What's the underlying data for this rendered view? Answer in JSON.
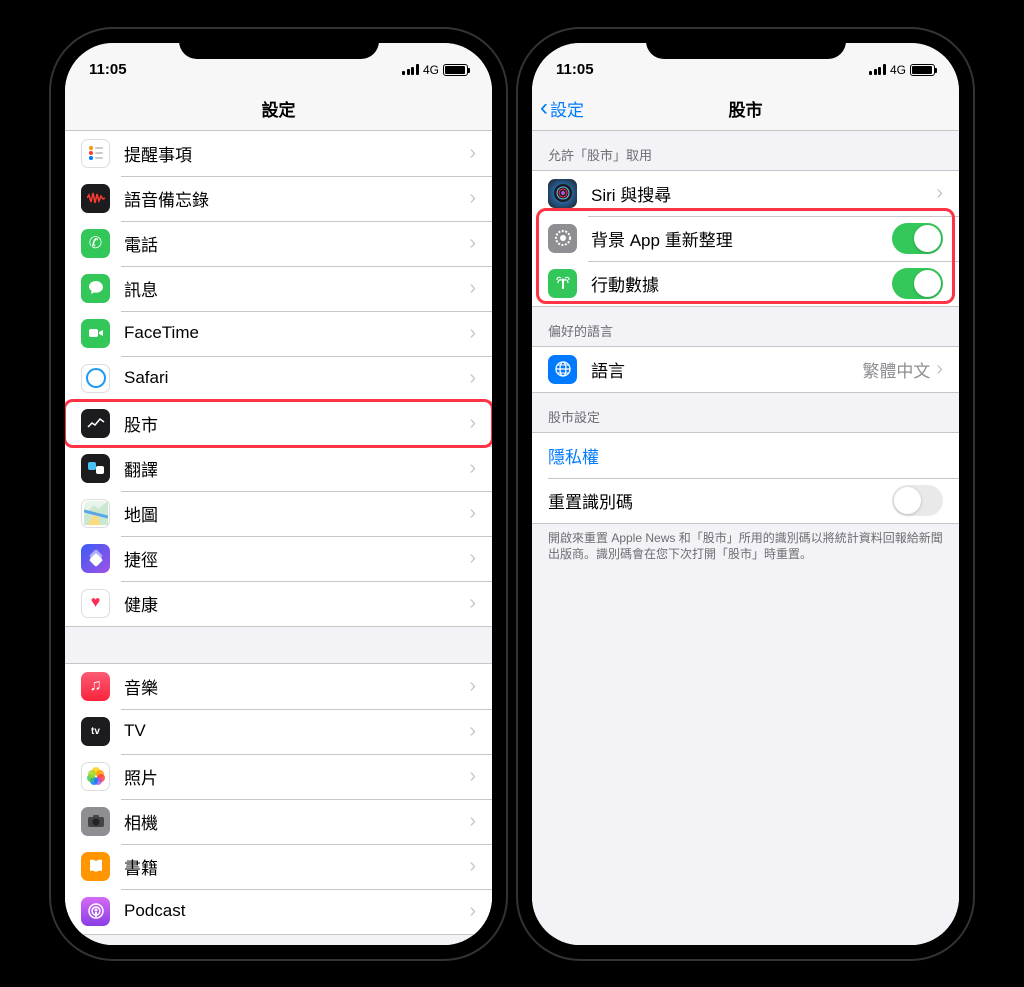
{
  "status": {
    "time": "11:05",
    "network": "4G"
  },
  "left": {
    "nav_title": "設定",
    "group1": [
      {
        "label": "提醒事項",
        "icon": "reminders"
      },
      {
        "label": "語音備忘錄",
        "icon": "voice"
      },
      {
        "label": "電話",
        "icon": "phone"
      },
      {
        "label": "訊息",
        "icon": "messages"
      },
      {
        "label": "FaceTime",
        "icon": "facetime"
      },
      {
        "label": "Safari",
        "icon": "safari"
      },
      {
        "label": "股市",
        "icon": "stocks",
        "highlighted": true
      },
      {
        "label": "翻譯",
        "icon": "translate"
      },
      {
        "label": "地圖",
        "icon": "maps"
      },
      {
        "label": "捷徑",
        "icon": "shortcuts"
      },
      {
        "label": "健康",
        "icon": "health"
      }
    ],
    "group2": [
      {
        "label": "音樂",
        "icon": "music"
      },
      {
        "label": "TV",
        "icon": "tv"
      },
      {
        "label": "照片",
        "icon": "photos"
      },
      {
        "label": "相機",
        "icon": "camera"
      },
      {
        "label": "書籍",
        "icon": "ibooks"
      },
      {
        "label": "Podcast",
        "icon": "podcast"
      }
    ]
  },
  "right": {
    "nav_back": "設定",
    "nav_title": "股市",
    "section_allow_header": "允許「股市」取用",
    "siri_label": "Siri 與搜尋",
    "bg_refresh_label": "背景 App 重新整理",
    "cellular_label": "行動數據",
    "section_lang_header": "偏好的語言",
    "lang_label": "語言",
    "lang_value": "繁體中文",
    "section_stocks_header": "股市設定",
    "privacy_label": "隱私權",
    "reset_id_label": "重置識別碼",
    "footer": "開啟來重置 Apple News 和「股市」所用的識別碼以將統計資料回報給新聞出版商。識別碼會在您下次打開「股市」時重置。"
  }
}
